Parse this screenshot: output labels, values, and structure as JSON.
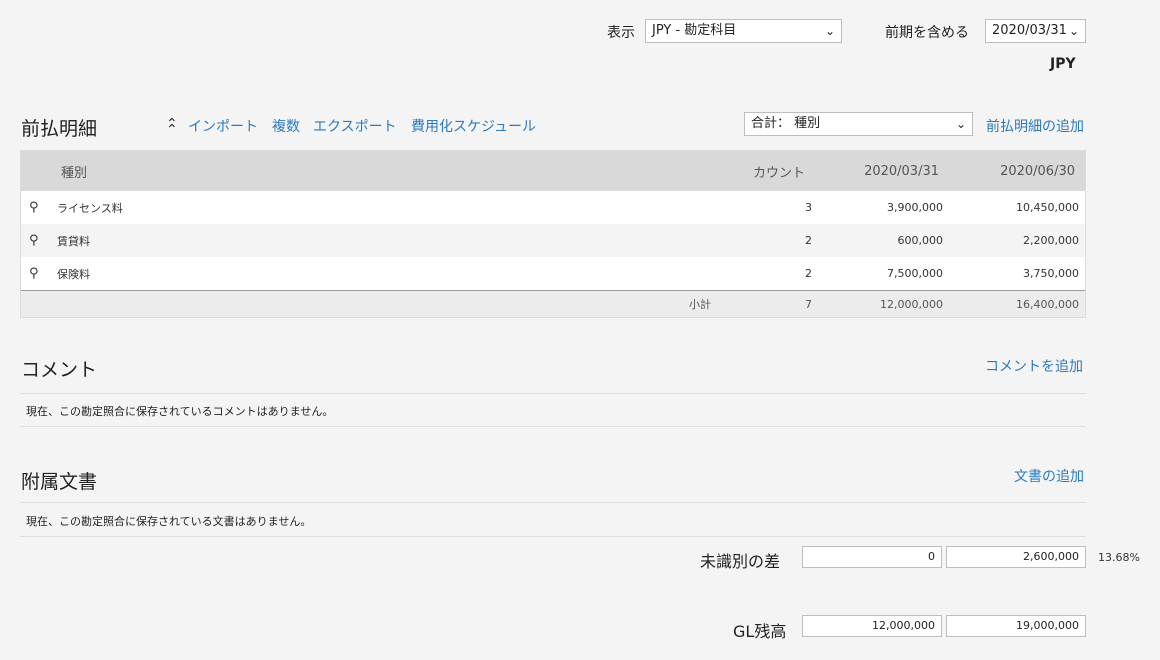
{
  "header": {
    "display_label": "表示",
    "display_value": "JPY - 勘定科目",
    "include_prior_label": "前期を含める",
    "include_prior_value": "2020/03/31",
    "currency": "JPY"
  },
  "prepaid": {
    "title": "前払明細",
    "actions": [
      "インポート",
      "複数",
      "エクスポート",
      "費用化スケジュール"
    ],
    "summary_select": "合計： 種別",
    "add_link": "前払明細の追加",
    "columns": [
      "種別",
      "カウント",
      "2020/03/31",
      "2020/06/30"
    ],
    "rows": [
      {
        "type": "ライセンス料",
        "count": "3",
        "v1": "3,900,000",
        "v2": "10,450,000"
      },
      {
        "type": "賃貸料",
        "count": "2",
        "v1": "600,000",
        "v2": "2,200,000"
      },
      {
        "type": "保険料",
        "count": "2",
        "v1": "7,500,000",
        "v2": "3,750,000"
      }
    ],
    "subtotal": {
      "label": "小計",
      "count": "7",
      "v1": "12,000,000",
      "v2": "16,400,000"
    }
  },
  "comments": {
    "title": "コメント",
    "add_link": "コメントを追加",
    "empty_text": "現在、この勘定照合に保存されているコメントはありません。"
  },
  "attachments": {
    "title": "附属文書",
    "add_link": "文書の追加",
    "empty_text": "現在、この勘定照合に保存されている文書はありません。"
  },
  "totals": {
    "unidentified_label": "未識別の差",
    "unidentified_v1": "0",
    "unidentified_v2": "2,600,000",
    "unidentified_pct": "13.68%",
    "gl_label": "GL残高",
    "gl_v1": "12,000,000",
    "gl_v2": "19,000,000"
  },
  "colors": {
    "link": "#2a7ac0",
    "header_bg": "#d9d9d9",
    "page_bg": "#f4f4f4"
  },
  "icons": [
    "chevron-down-icon",
    "double-chevron-up-icon",
    "magnifier-icon"
  ]
}
